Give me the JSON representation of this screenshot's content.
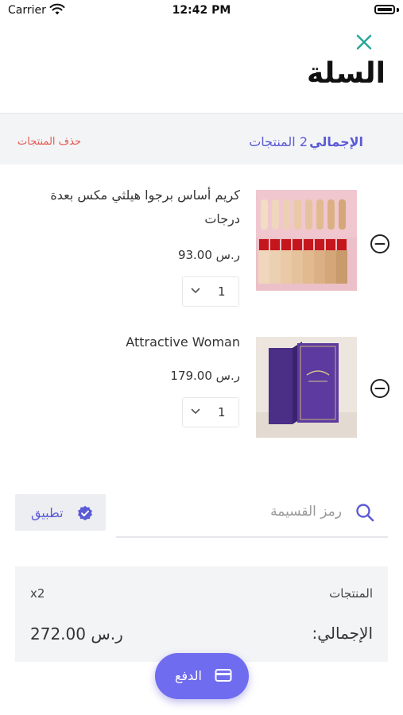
{
  "status_bar": {
    "carrier": "Carrier",
    "time": "12:42 PM"
  },
  "header": {
    "title": "السلة"
  },
  "summary": {
    "total_label": "الإجمالي",
    "count_text": "2 المنتجات",
    "delete_label": "حذف المنتجات"
  },
  "items": [
    {
      "name": "كريم أساس برجوا هيلثي مكس بعدة درجات",
      "price": "93.00 ر.س",
      "quantity": "1"
    },
    {
      "name": "Attractive Woman",
      "price": "179.00 ر.س",
      "quantity": "1"
    }
  ],
  "coupon": {
    "placeholder": "رمز القسيمة",
    "apply_label": "تطبيق"
  },
  "totals": {
    "products_label": "المنتجات",
    "products_count": "x2",
    "grand_label": "الإجمالي:",
    "grand_value": "272.00 ر.س"
  },
  "checkout": {
    "label": "الدفع"
  },
  "colors": {
    "accent": "#6f6cf0",
    "danger": "#e5574f",
    "close": "#2aa79b"
  }
}
